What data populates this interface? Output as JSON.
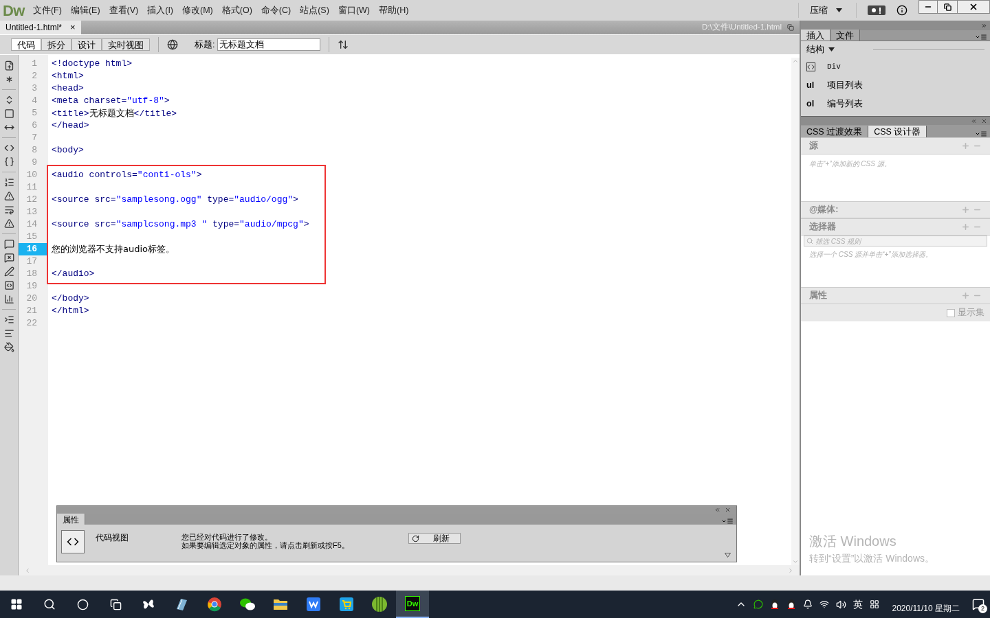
{
  "app": {
    "logo": "Dw",
    "menu": [
      "文件(F)",
      "编辑(E)",
      "查看(V)",
      "插入(I)",
      "修改(M)",
      "格式(O)",
      "命令(C)",
      "站点(S)",
      "窗口(W)",
      "帮助(H)"
    ],
    "workspace": "压缩"
  },
  "document_tab": {
    "label": "Untitled-1.html*",
    "close": "×",
    "path": "D:\\文件\\Untitled-1.html"
  },
  "view_buttons": [
    {
      "label": "代码",
      "selected": true
    },
    {
      "label": "拆分",
      "selected": false
    },
    {
      "label": "设计",
      "selected": false
    },
    {
      "label": "实时视图",
      "selected": false
    }
  ],
  "title_field": {
    "label": "标题:",
    "value": "无标题文档"
  },
  "code": {
    "blocks": [
      {
        "boxed": false,
        "lines": [
          {
            "number": "1",
            "selected": false,
            "segments": [
              {
                "kind": "tag",
                "text": "<!doctype html>"
              }
            ]
          },
          {
            "number": "2",
            "selected": false,
            "segments": [
              {
                "kind": "tag",
                "text": "<html>"
              }
            ]
          },
          {
            "number": "3",
            "selected": false,
            "segments": [
              {
                "kind": "tag",
                "text": "<head>"
              }
            ]
          },
          {
            "number": "4",
            "selected": false,
            "segments": [
              {
                "kind": "tag",
                "text": "<meta charset="
              },
              {
                "kind": "value",
                "text": "\"utf-8\""
              },
              {
                "kind": "tag",
                "text": ">"
              }
            ]
          },
          {
            "number": "5",
            "selected": false,
            "segments": [
              {
                "kind": "tag",
                "text": "<title>"
              },
              {
                "kind": "plain",
                "text": "无标题文档"
              },
              {
                "kind": "tag",
                "text": "</title>"
              }
            ]
          },
          {
            "number": "6",
            "selected": false,
            "segments": [
              {
                "kind": "tag",
                "text": "</head>"
              }
            ]
          },
          {
            "number": "7",
            "selected": false
          },
          {
            "number": "8",
            "selected": false,
            "segments": [
              {
                "kind": "tag",
                "text": "<body>"
              }
            ]
          },
          {
            "number": "9",
            "selected": false
          }
        ]
      },
      {
        "boxed": true,
        "lines": [
          {
            "number": "10",
            "selected": false,
            "segments": [
              {
                "kind": "tag",
                "text": "<audio controls="
              },
              {
                "kind": "value",
                "text": "\"conti-ols\""
              },
              {
                "kind": "tag",
                "text": ">"
              }
            ]
          },
          {
            "number": "11",
            "selected": false
          },
          {
            "number": "12",
            "selected": false,
            "segments": [
              {
                "kind": "tag",
                "text": "<source src="
              },
              {
                "kind": "value",
                "text": "\"samplesong.ogg\""
              },
              {
                "kind": "tag",
                "text": " type="
              },
              {
                "kind": "value",
                "text": "\"audio/ogg\""
              },
              {
                "kind": "tag",
                "text": ">"
              }
            ]
          },
          {
            "number": "13",
            "selected": false
          },
          {
            "number": "14",
            "selected": false,
            "segments": [
              {
                "kind": "tag",
                "text": "<source src="
              },
              {
                "kind": "value",
                "text": "\"samplcsong.mp3 \""
              },
              {
                "kind": "tag",
                "text": " type="
              },
              {
                "kind": "value",
                "text": "\"audio/mpcg\""
              },
              {
                "kind": "tag",
                "text": ">"
              }
            ]
          },
          {
            "number": "15",
            "selected": false
          },
          {
            "number": "16",
            "selected": true,
            "segments": [
              {
                "kind": "plain",
                "text": "您的浏览器不支持audio标签。"
              }
            ]
          },
          {
            "number": "17",
            "selected": false
          },
          {
            "number": "18",
            "selected": false,
            "segments": [
              {
                "kind": "tag",
                "text": "</audio>"
              }
            ]
          }
        ]
      },
      {
        "boxed": false,
        "lines": [
          {
            "number": "19",
            "selected": false
          },
          {
            "number": "20",
            "selected": false,
            "segments": [
              {
                "kind": "tag",
                "text": "</body>"
              }
            ]
          },
          {
            "number": "21",
            "selected": false,
            "segments": [
              {
                "kind": "tag",
                "text": "</html>"
              }
            ]
          },
          {
            "number": "22",
            "selected": false
          }
        ]
      }
    ]
  },
  "insert_panel": {
    "tabs": [
      {
        "label": "插入",
        "selected": true
      },
      {
        "label": "文件",
        "selected": false
      }
    ],
    "category": "结构",
    "items": [
      {
        "kind": "icon",
        "label": "Div"
      },
      {
        "kind": "text",
        "mark": "ul",
        "label": "项目列表"
      },
      {
        "kind": "text",
        "mark": "ol",
        "label": "编号列表"
      }
    ]
  },
  "css_panel": {
    "tabs": [
      {
        "label": "CSS 过渡效果",
        "selected": false
      },
      {
        "label": "CSS 设计器",
        "selected": true
      }
    ],
    "sources": {
      "title": "源",
      "hint": "单击“+”添加新的 CSS 源。"
    },
    "media": {
      "title": "@媒体:"
    },
    "selectors": {
      "title": "选择器",
      "placeholder": "筛选 CSS 规则",
      "hint": "选择一个 CSS 源并单击“+”添加选择器。"
    },
    "properties": {
      "title": "属性",
      "show_set": {
        "label": "显示集",
        "checked": false
      }
    }
  },
  "activation": {
    "title": "激活 Windows",
    "text": "转到“设置”以激活 Windows。"
  },
  "properties_panel": {
    "tab": "属性",
    "view": "代码视图",
    "message": [
      "您已经对代码进行了修改。",
      "如果要编辑选定对象的属性，请点击刷新或按F5。"
    ],
    "refresh": "刷新"
  },
  "taskbar": {
    "apps": [
      {
        "kind": "pinwheel",
        "color": "#ffffff"
      },
      {
        "kind": "notes",
        "color": "#7fb3d5"
      },
      {
        "kind": "chrome",
        "color": "#db4437"
      },
      {
        "kind": "wechat",
        "color": "#2dc100"
      },
      {
        "kind": "folder",
        "color": "#f2c94c"
      },
      {
        "kind": "wps",
        "color": "#2f7cf6"
      },
      {
        "kind": "store",
        "color": "#1fa3e8"
      },
      {
        "kind": "melon",
        "color": "#7cb82f"
      },
      {
        "kind": "dw",
        "color": "#0a0a0a",
        "label": "Dw",
        "selected": true
      }
    ],
    "ime": "英",
    "date": "2020/11/10 星期二",
    "badge": "2"
  }
}
